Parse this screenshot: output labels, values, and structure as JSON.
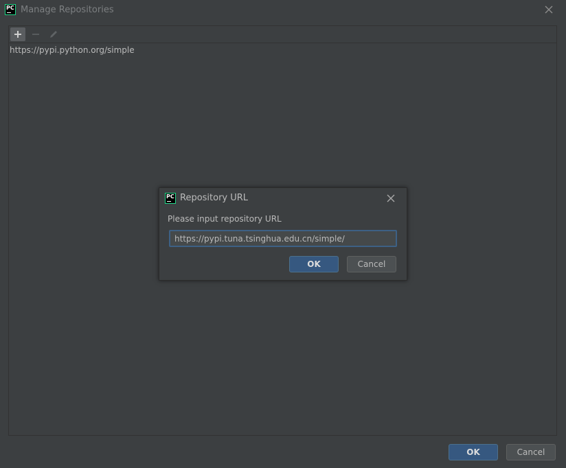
{
  "window": {
    "title": "Manage Repositories",
    "app_icon_text": "PC"
  },
  "toolbar": {
    "add_icon": "plus-icon",
    "remove_icon": "minus-icon",
    "edit_icon": "pencil-icon"
  },
  "repositories": [
    "https://pypi.python.org/simple"
  ],
  "footer": {
    "ok_label": "OK",
    "cancel_label": "Cancel"
  },
  "dialog": {
    "title": "Repository URL",
    "app_icon_text": "PC",
    "prompt": "Please input repository URL",
    "input_value": "https://pypi.tuna.tsinghua.edu.cn/simple/",
    "ok_label": "OK",
    "cancel_label": "Cancel"
  },
  "colors": {
    "background": "#3c3f41",
    "primary_button": "#365880",
    "focus_border": "#3d6185",
    "app_icon_accent": "#21d789"
  }
}
